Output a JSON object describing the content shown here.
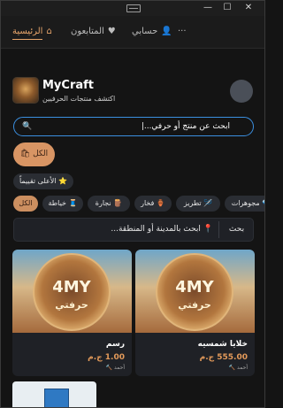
{
  "nav": {
    "home_label": "الرئيسية",
    "following_label": "المتابعون",
    "account_label": "حسابي",
    "more_label": "···"
  },
  "profile": {
    "brand": "MyCraft",
    "tagline": "اكتشف منتجات الحرفيين"
  },
  "search": {
    "text": "ابحث عن منتج أو حرفي...|"
  },
  "filters": {
    "all_label": "الكل 🛍",
    "top_rated_label": "⭐ الأعلى تقييماً"
  },
  "categories": [
    {
      "label": "الكل"
    },
    {
      "label": "🧵 خياطة"
    },
    {
      "label": "🪵 نجارة"
    },
    {
      "label": "🏺 فخار"
    },
    {
      "label": "🪡 تطريز"
    },
    {
      "label": "💎 مجوهرات"
    }
  ],
  "city_search": {
    "placeholder": "📍 ابحث بالمدينة أو المنطقة...",
    "button_label": "بحث"
  },
  "products": [
    {
      "name": "خلايا شمسيه",
      "price": "555.00 ج.م",
      "seller": "أحمد 🔨",
      "image_title": "4MY",
      "image_subtitle": "حرفتي"
    },
    {
      "name": "رسم",
      "price": "1.00 ج.م",
      "seller": "أحمد 🔨",
      "image_title": "4MY",
      "image_subtitle": "حرفتي"
    }
  ],
  "colors": {
    "accent": "#d89564",
    "price": "#e39a5a",
    "search_border": "#3b8fe0",
    "background": "#141414"
  }
}
